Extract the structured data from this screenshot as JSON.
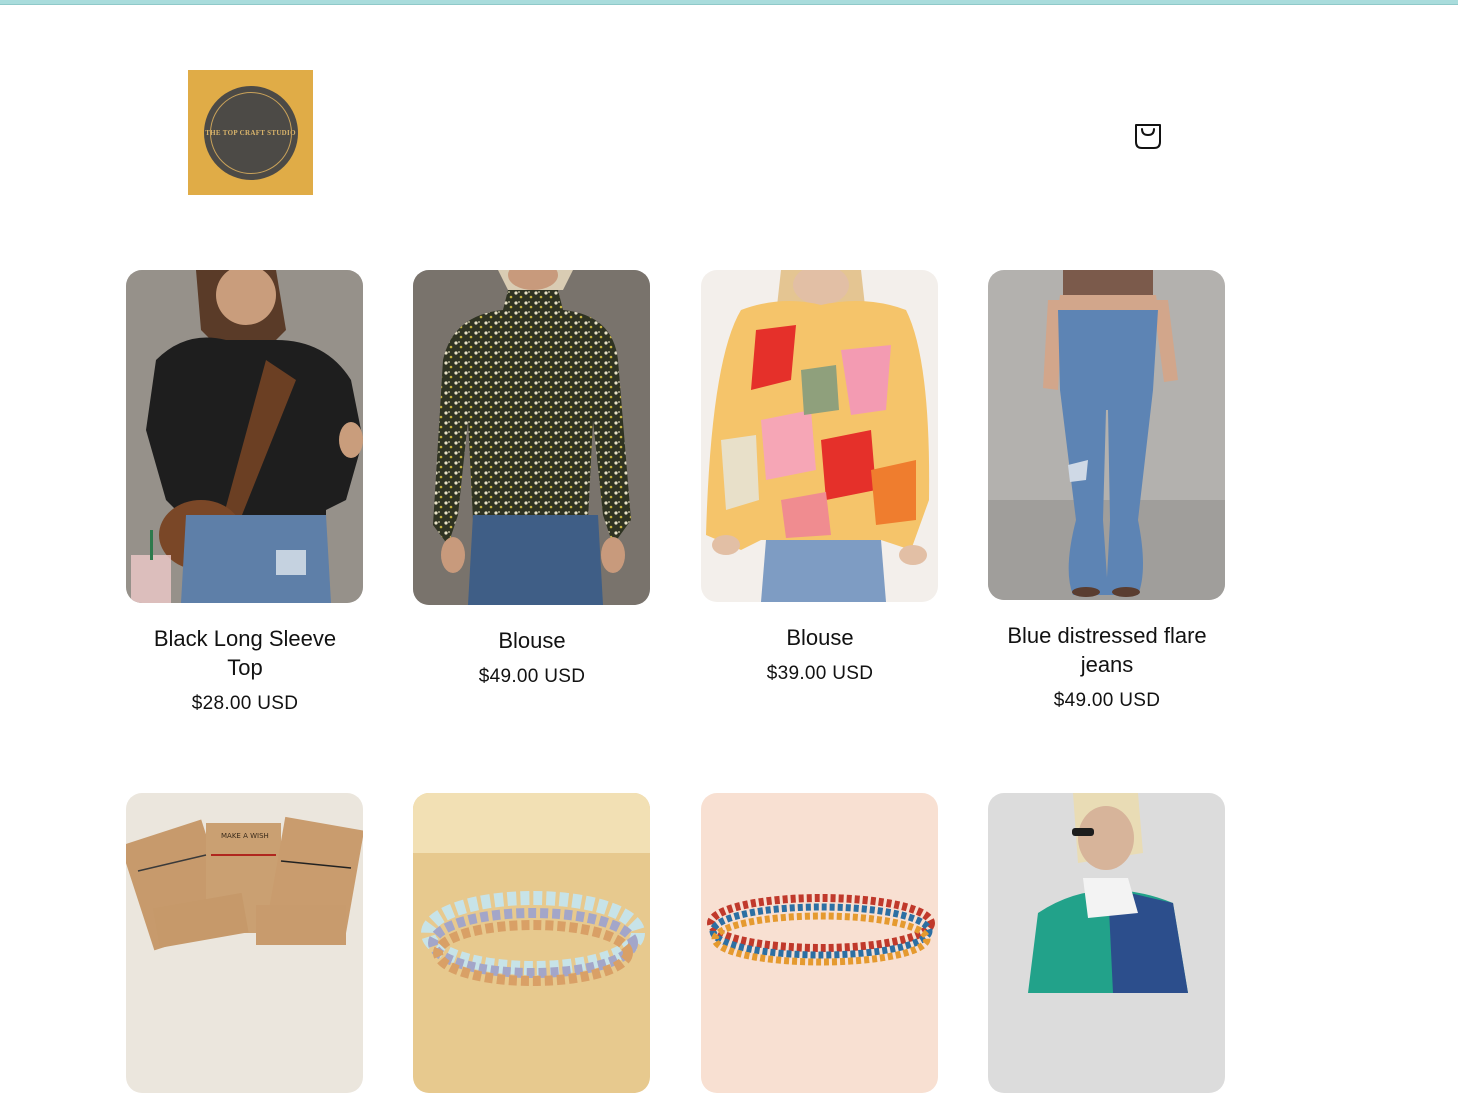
{
  "store": {
    "logo_text": "THE TOP CRAFT STUDIO",
    "cart_icon": "shopping-bag-icon"
  },
  "products": [
    {
      "title": "Black Long Sleeve Top",
      "price": "$28.00 USD"
    },
    {
      "title": "Blouse",
      "price": "$49.00 USD"
    },
    {
      "title": "Blouse",
      "price": "$39.00 USD"
    },
    {
      "title": "Blue distressed flare jeans",
      "price": "$49.00 USD"
    }
  ],
  "products_row2": {
    "card1_text": "MAKE A WISH"
  },
  "colors": {
    "top_strip": "#a9dcdc",
    "logo_background": "#e0ac47",
    "logo_badge": "#4c4a46"
  }
}
